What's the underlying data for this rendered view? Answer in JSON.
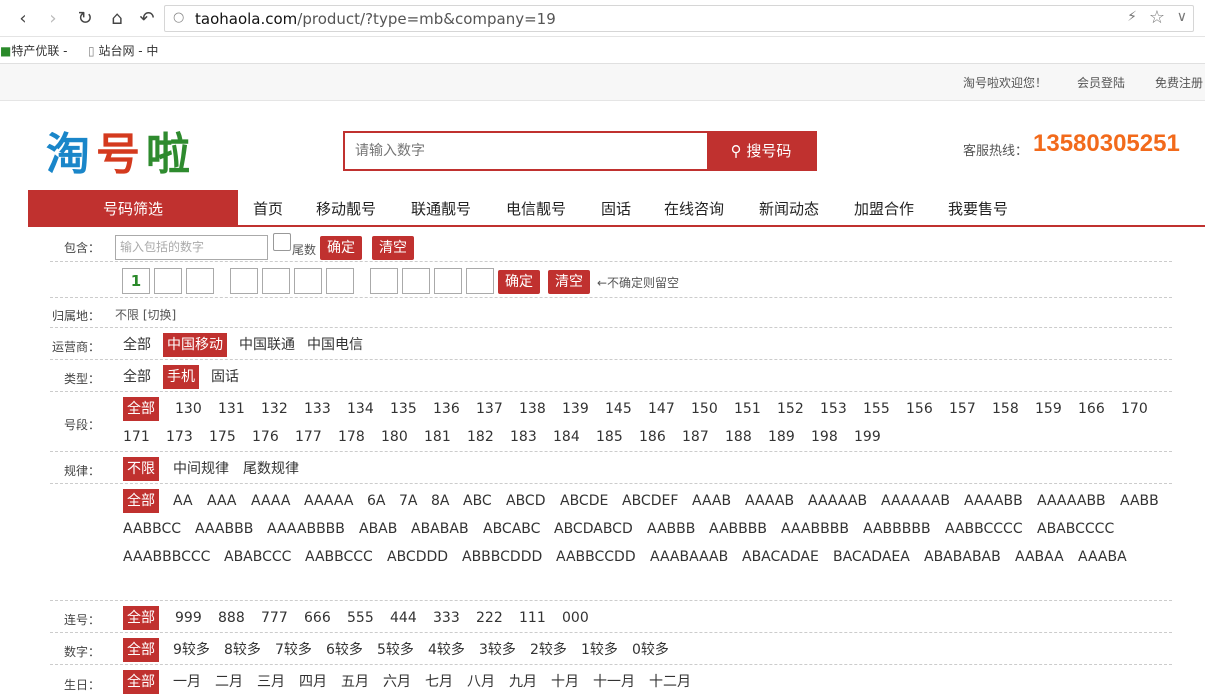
{
  "browser": {
    "url_host": "taohaola.com",
    "url_rest": "/product/?type=mb&company=19",
    "bookmarks": [
      "特产优联 -",
      "站台网 - 中"
    ]
  },
  "topbar": {
    "welcome": "淘号啦欢迎您！",
    "login": "会员登陆",
    "register": "免费注册"
  },
  "header": {
    "logo": [
      "淘",
      "号",
      "啦"
    ],
    "search_placeholder": "请输入数字",
    "search_button": "搜号码",
    "hotline_label": "客服热线：",
    "hotline_number": "13580305251"
  },
  "nav": {
    "filter_title": "号码筛选",
    "items": [
      "首页",
      "移动靓号",
      "联通靓号",
      "电信靓号",
      "固话",
      "在线咨询",
      "新闻动态",
      "加盟合作",
      "我要售号"
    ]
  },
  "filters": {
    "contains": {
      "label": "包含：",
      "placeholder": "输入包括的数字",
      "tail_label": "尾数",
      "confirm": "确定",
      "clear": "清空"
    },
    "digits": {
      "first_digit": "1",
      "confirm": "确定",
      "clear": "清空",
      "hint": "←不确定则留空"
    },
    "location": {
      "label": "归属地：",
      "value": "不限 [切换]"
    },
    "carrier": {
      "label": "运营商：",
      "options": [
        "全部",
        "中国移动",
        "中国联通",
        "中国电信"
      ],
      "selected": "中国移动"
    },
    "type": {
      "label": "类型：",
      "options": [
        "全部",
        "手机",
        "固话"
      ],
      "selected": "手机"
    },
    "prefix": {
      "label": "号段：",
      "options": [
        "全部",
        "130",
        "131",
        "132",
        "133",
        "134",
        "135",
        "136",
        "137",
        "138",
        "139",
        "145",
        "147",
        "150",
        "151",
        "152",
        "153",
        "155",
        "156",
        "157",
        "158",
        "159",
        "166",
        "170",
        "171",
        "173",
        "175",
        "176",
        "177",
        "178",
        "180",
        "181",
        "182",
        "183",
        "184",
        "185",
        "186",
        "187",
        "188",
        "189",
        "198",
        "199"
      ],
      "selected": "全部"
    },
    "pattern": {
      "label": "规律：",
      "options": [
        "不限",
        "中间规律",
        "尾数规律"
      ],
      "selected": "不限"
    },
    "pattern_types": {
      "options": [
        "全部",
        "AA",
        "AAA",
        "AAAA",
        "AAAAA",
        "6A",
        "7A",
        "8A",
        "ABC",
        "ABCD",
        "ABCDE",
        "ABCDEF",
        "AAAB",
        "AAAAB",
        "AAAAAB",
        "AAAAAAB",
        "AAAABB",
        "AAAAABB",
        "AABB",
        "AABBCC",
        "AAABBB",
        "AAAABBBB",
        "ABAB",
        "ABABAB",
        "ABCABC",
        "ABCDABCD",
        "AABBB",
        "AABBBB",
        "AAABBBB",
        "AABBBBB",
        "AABBCCCC",
        "ABABCCCC",
        "AAABBBCCC",
        "ABABCCC",
        "AABBCCC",
        "ABCDDD",
        "ABBBCDDD",
        "AABBCCDD",
        "AAABAAAB",
        "ABACADAE",
        "BACADAEA",
        "ABABABAB",
        "AABAA",
        "AAABA"
      ],
      "selected": "全部"
    },
    "sequence": {
      "label": "连号：",
      "options": [
        "全部",
        "999",
        "888",
        "777",
        "666",
        "555",
        "444",
        "333",
        "222",
        "111",
        "000"
      ],
      "selected": "全部"
    },
    "digit_count": {
      "label": "数字：",
      "options": [
        "全部",
        "9较多",
        "8较多",
        "7较多",
        "6较多",
        "5较多",
        "4较多",
        "3较多",
        "2较多",
        "1较多",
        "0较多"
      ],
      "selected": "全部"
    },
    "birthday": {
      "label": "生日：",
      "options": [
        "全部",
        "一月",
        "二月",
        "三月",
        "四月",
        "五月",
        "六月",
        "七月",
        "八月",
        "九月",
        "十月",
        "十一月",
        "十二月"
      ],
      "selected": "全部"
    }
  }
}
